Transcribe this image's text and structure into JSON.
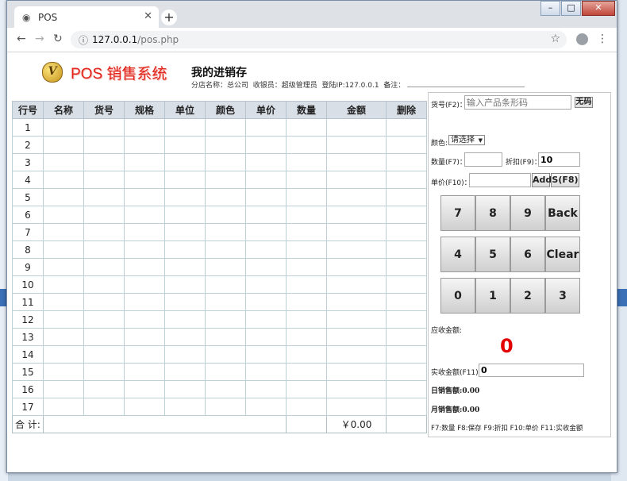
{
  "browser": {
    "tab_title": "POS",
    "url_host": "127.0.0.1",
    "url_path": "/pos.php",
    "window_controls": [
      "–",
      "□",
      "✕"
    ]
  },
  "header": {
    "brand": "POS 销售系统",
    "page_title": "我的进销存",
    "store_label": "分店名称：总公司",
    "cashier_label": "收银员：超级管理员",
    "ip_label": "登陆IP:127.0.0.1",
    "note_label": "备注："
  },
  "table": {
    "columns": [
      "行号",
      "名称",
      "货号",
      "规格",
      "单位",
      "颜色",
      "单价",
      "数量",
      "金额",
      "删除"
    ],
    "rows": [
      1,
      2,
      3,
      4,
      5,
      6,
      7,
      8,
      9,
      10,
      11,
      12,
      13,
      14,
      15,
      16,
      17
    ],
    "total_label": "合 计:",
    "total_amount": "￥0.00"
  },
  "panel": {
    "sku_label": "货号(F2)：",
    "sku_placeholder": "输入产品条形码",
    "no_code_button": "无码",
    "color_label": "颜色:",
    "color_select": "请选择",
    "qty_label": "数量(F7)：",
    "qty_value": "",
    "discount_label": "折扣(F9)：",
    "discount_value": "10",
    "price_label": "单价(F10)：",
    "price_value": "",
    "add_button": "Add",
    "save_button": "S(F8)",
    "keypad": [
      "7",
      "8",
      "9",
      "Back",
      "4",
      "5",
      "6",
      "Clear",
      "0",
      "1",
      "2",
      "3"
    ],
    "due_label": "应收金额:",
    "due_value": "0",
    "received_label": "实收金额(F11):",
    "received_value": "0",
    "daily_sales": "日销售额:0.00",
    "monthly_sales": "月销售额:0.00",
    "shortcuts": "F7:数量 F8:保存 F9:折扣 F10:单价 F11:实收金额"
  },
  "colors": {
    "brand_red": "#e2231a",
    "due_red": "#e20000",
    "header_bg": "#d9dfe6"
  }
}
